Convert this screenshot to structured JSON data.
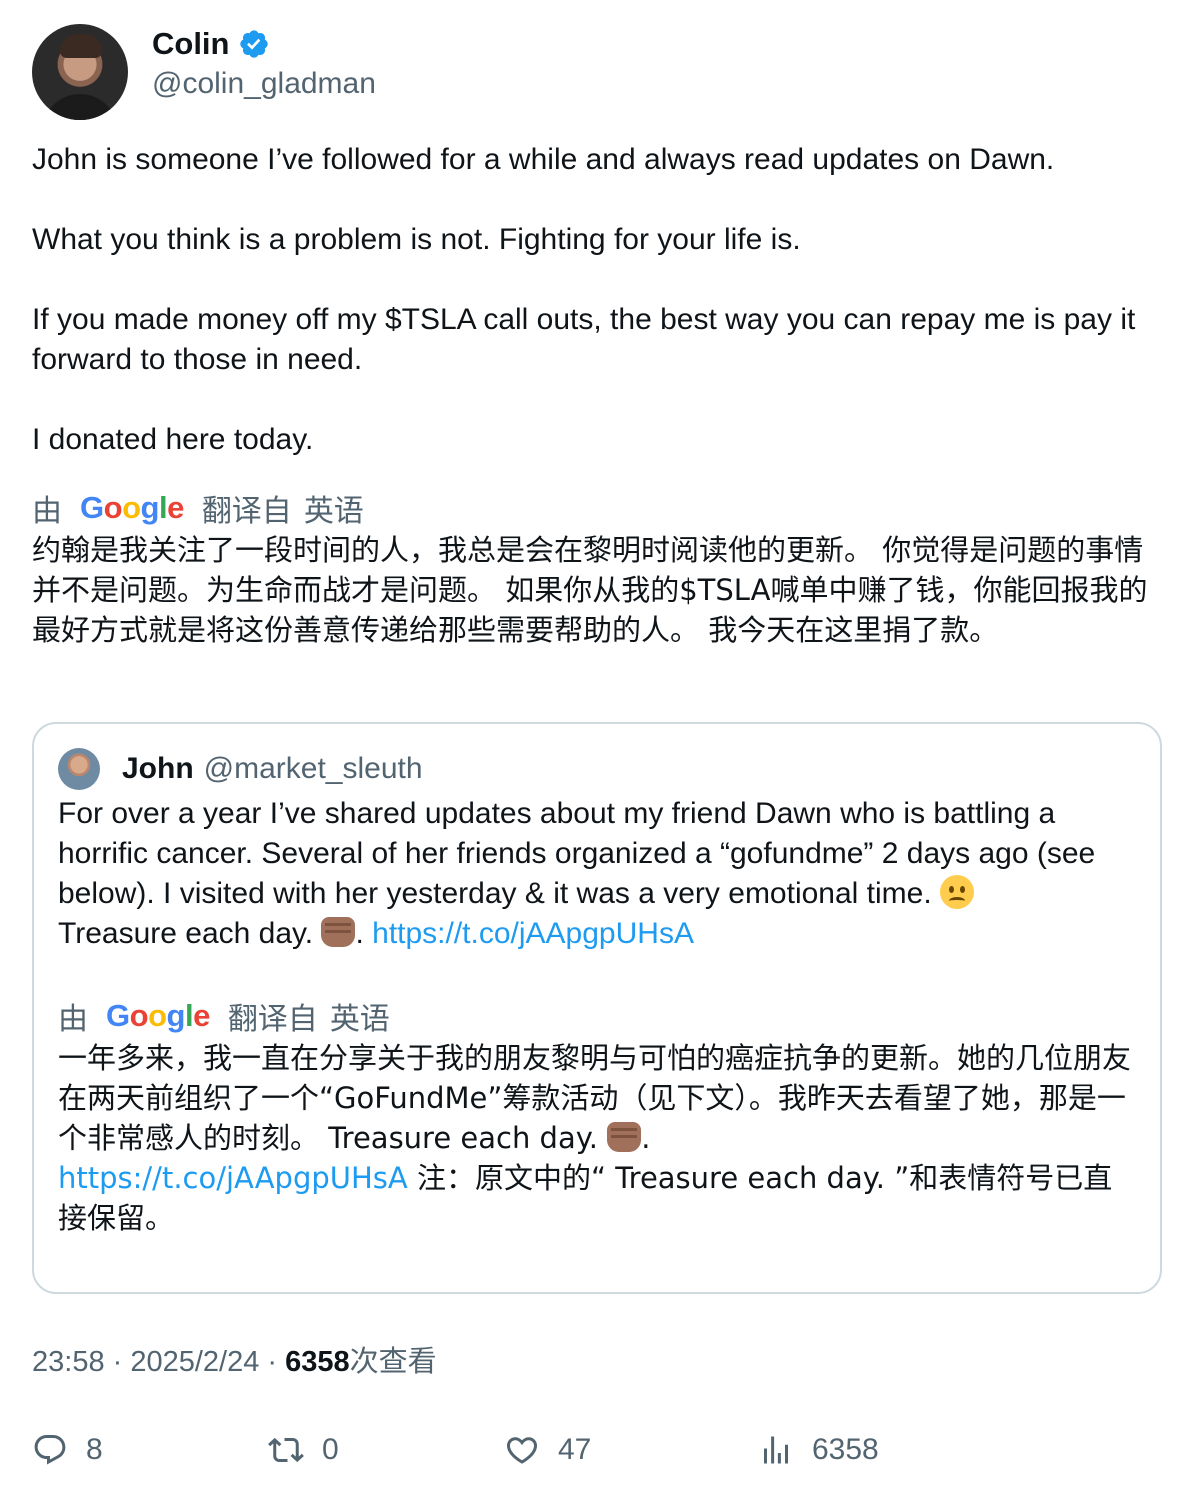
{
  "author": {
    "display_name": "Colin",
    "handle": "@colin_gladman",
    "verified_color": "#1d9bf0"
  },
  "tweet": {
    "paragraphs": [
      "John is someone I’ve followed for a while and always read updates on Dawn.",
      "",
      "What you think is a problem is not. Fighting for your life is.",
      "",
      "If you made money off my $TSLA call outs, the best way you can repay me is pay it forward to those in need.",
      "",
      "I donated here today."
    ]
  },
  "translation": {
    "prefix": "由",
    "provider": "Google",
    "suffix": "翻译自",
    "language": "英语",
    "text": "约翰是我关注了一段时间的人，我总是会在黎明时阅读他的更新。 你觉得是问题的事情并不是问题。为生命而战才是问题。 如果你从我的$TSLA喊单中赚了钱，你能回报我的最好方式就是将这份善意传递给那些需要帮助的人。 我今天在这里捐了款。"
  },
  "quote": {
    "display_name": "John",
    "handle": "@market_sleuth",
    "text_part1": "For over a year I’ve shared updates about my friend Dawn who is battling a horrific cancer. Several of her friends organized a “gofundme” 2 days ago (see below). I visited with her yesterday & it was a very emotional time. ",
    "text_part2": "Treasure each day. ",
    "text_part3": ". ",
    "link": "https://t.co/jAApgpUHsA",
    "translation": {
      "prefix": "由",
      "provider": "Google",
      "suffix": "翻译自",
      "language": "英语",
      "text_part1": "一年多来，我一直在分享关于我的朋友黎明与可怕的癌症抗争的更新。她的几位朋友在两天前组织了一个“GoFundMe”筹款活动（见下文）。我昨天去看望了她，那是一个非常感人的时刻。 Treasure each day. ",
      "text_part2": ".",
      "link": "https://t.co/jAApgpUHsA",
      "text_part3": " 注：原文中的“ Treasure each day. ”和表情符号已直接保留。"
    }
  },
  "meta": {
    "time": "23:58",
    "separator": " · ",
    "date": "2025/2/24",
    "views_count": "6358",
    "views_label": "次查看"
  },
  "actions": {
    "replies": "8",
    "retweets": "0",
    "likes": "47",
    "views": "6358"
  }
}
